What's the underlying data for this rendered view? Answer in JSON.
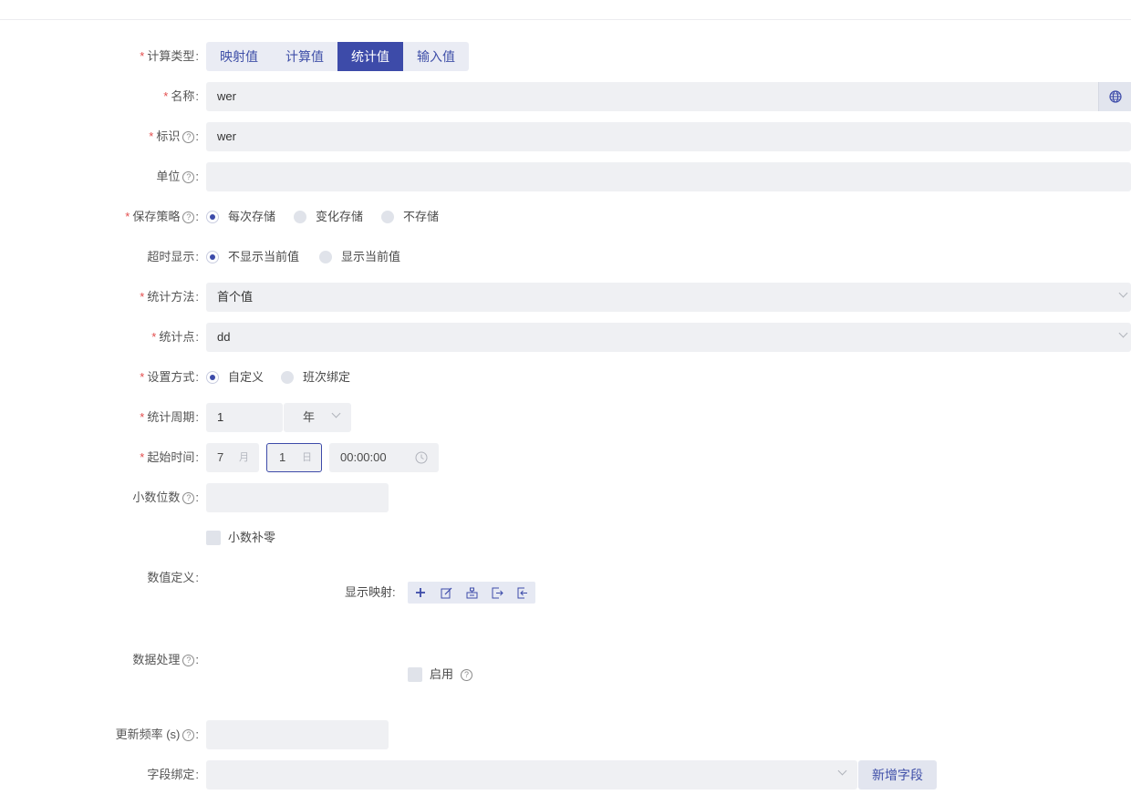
{
  "form": {
    "calc_type": {
      "label": "计算类型",
      "options": [
        "映射值",
        "计算值",
        "统计值",
        "输入值"
      ],
      "selected": "统计值"
    },
    "name": {
      "label": "名称",
      "value": "wer"
    },
    "identifier": {
      "label": "标识",
      "value": "wer"
    },
    "unit": {
      "label": "单位",
      "value": ""
    },
    "save_strategy": {
      "label": "保存策略",
      "options": [
        "每次存储",
        "变化存储",
        "不存储"
      ],
      "selected": "每次存储"
    },
    "timeout_display": {
      "label": "超时显示",
      "options": [
        "不显示当前值",
        "显示当前值"
      ],
      "selected": "不显示当前值"
    },
    "stat_method": {
      "label": "统计方法",
      "value": "首个值"
    },
    "stat_point": {
      "label": "统计点",
      "value": "dd"
    },
    "setting_mode": {
      "label": "设置方式",
      "options": [
        "自定义",
        "班次绑定"
      ],
      "selected": "自定义"
    },
    "stat_period": {
      "label": "统计周期",
      "value": "1",
      "unit": "年"
    },
    "start_time": {
      "label": "起始时间",
      "month": "7",
      "month_unit": "月",
      "day": "1",
      "day_unit": "日",
      "time": "00:00:00"
    },
    "decimals": {
      "label": "小数位数",
      "value": "",
      "pad_zero_label": "小数补零"
    },
    "value_def": {
      "label": "数值定义",
      "display_mapping_label": "显示映射"
    },
    "data_processing": {
      "label": "数据处理",
      "enable_label": "启用"
    },
    "update_freq": {
      "label": "更新频率 (s)",
      "value": ""
    },
    "field_binding": {
      "label": "字段绑定",
      "value": "",
      "add_button": "新增字段"
    }
  },
  "colors": {
    "accent": "#3d4ba9",
    "required": "#e34d4d",
    "input_bg": "#eff0f3"
  },
  "icons": [
    "help-icon",
    "globe-icon",
    "chevron-down-icon",
    "clock-icon",
    "plus-icon",
    "edit-icon",
    "structure-icon",
    "import-icon",
    "export-icon"
  ]
}
